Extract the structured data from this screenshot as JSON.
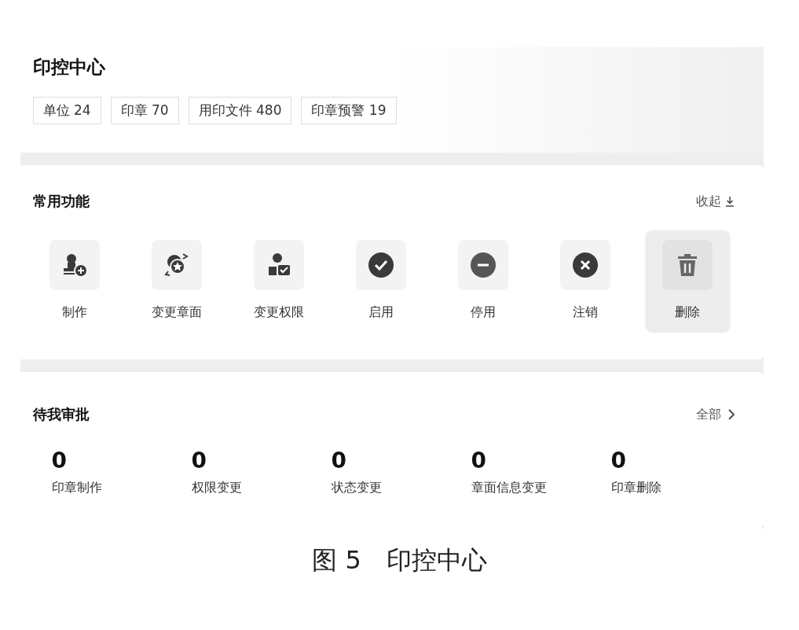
{
  "header": {
    "title": "印控中心",
    "stats": [
      "单位 24",
      "印章 70",
      "用印文件 480",
      "印章预警 19"
    ]
  },
  "functions": {
    "title": "常用功能",
    "toggle": "收起",
    "actions": [
      {
        "label": "制作",
        "selected": false
      },
      {
        "label": "变更章面",
        "selected": false
      },
      {
        "label": "变更权限",
        "selected": false
      },
      {
        "label": "启用",
        "selected": false
      },
      {
        "label": "停用",
        "selected": false
      },
      {
        "label": "注销",
        "selected": false
      },
      {
        "label": "删除",
        "selected": true
      }
    ]
  },
  "approvals": {
    "title": "待我审批",
    "link": "全部",
    "items": [
      {
        "count": "0",
        "label": "印章制作"
      },
      {
        "count": "0",
        "label": "权限变更"
      },
      {
        "count": "0",
        "label": "状态变更"
      },
      {
        "count": "0",
        "label": "章面信息变更"
      },
      {
        "count": "0",
        "label": "印章删除"
      }
    ]
  },
  "caption": "图 5　印控中心"
}
